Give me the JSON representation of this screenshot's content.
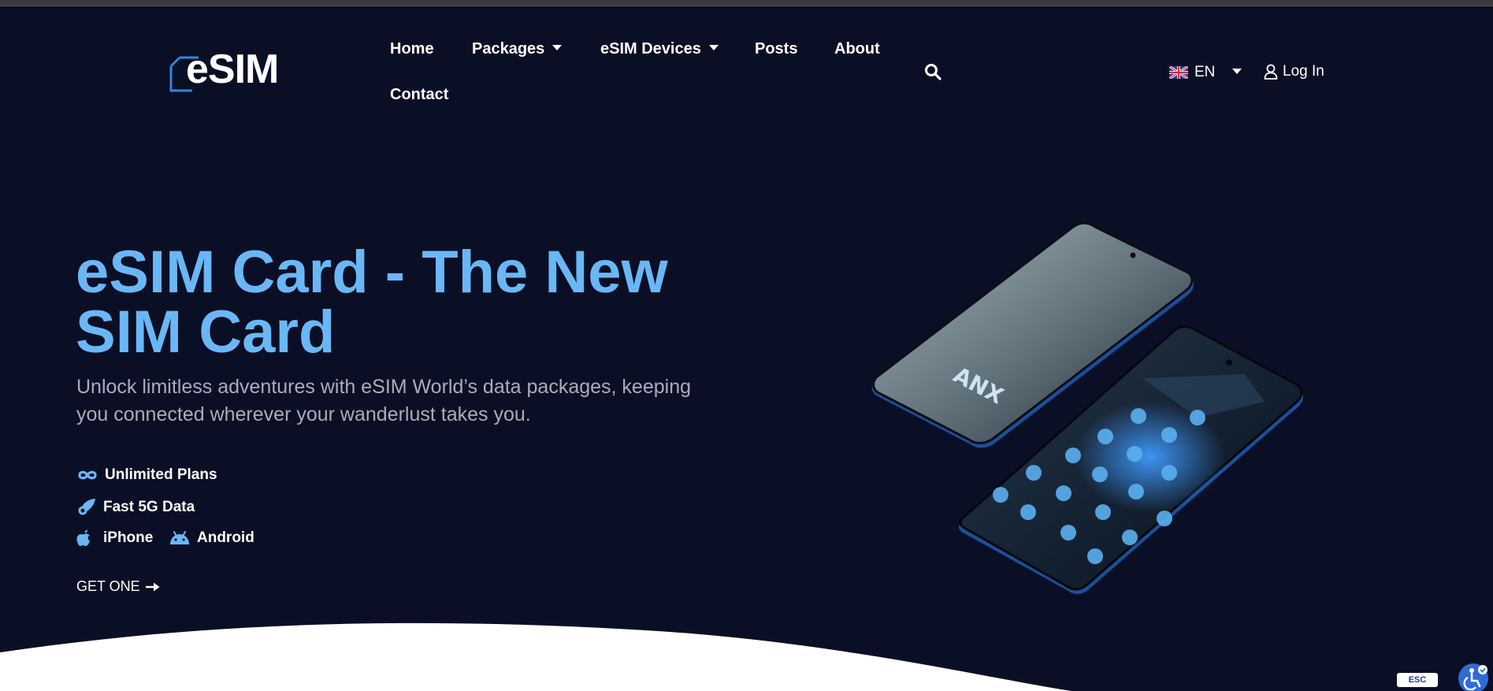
{
  "header": {
    "logo_text": "eSIM",
    "nav": [
      {
        "label": "Home",
        "has_dropdown": false
      },
      {
        "label": "Packages",
        "has_dropdown": true
      },
      {
        "label": "eSIM Devices",
        "has_dropdown": true
      },
      {
        "label": "Posts",
        "has_dropdown": false
      },
      {
        "label": "About",
        "has_dropdown": false
      },
      {
        "label": "Contact",
        "has_dropdown": false
      }
    ],
    "search_icon": "search-icon",
    "language": {
      "code": "EN",
      "flag": "uk-flag-icon"
    },
    "login_label": "Log In"
  },
  "hero": {
    "title_line1": "eSIM Card - The New",
    "title_line2": "SIM Card",
    "subtitle_line1": "Unlock limitless adventures with eSIM World’s data packages, keeping",
    "subtitle_line2": "you connected wherever your wanderlust takes you.",
    "features": [
      {
        "label": "Unlimited Plans",
        "icon": "infinity-icon"
      },
      {
        "label": "Fast 5G Data",
        "icon": "rocket-icon"
      },
      {
        "label": "iPhone",
        "icon": "apple-icon"
      },
      {
        "label": "Android",
        "icon": "android-icon"
      }
    ],
    "cta_label": "GET ONE",
    "phone_brand_text": "ANX"
  },
  "widgets": {
    "esc_label": "ESC"
  },
  "colors": {
    "background": "#0b0f26",
    "accent": "#6ab7f5",
    "logo_blue": "#2f86e0",
    "subtitle": "#a9adbb"
  }
}
